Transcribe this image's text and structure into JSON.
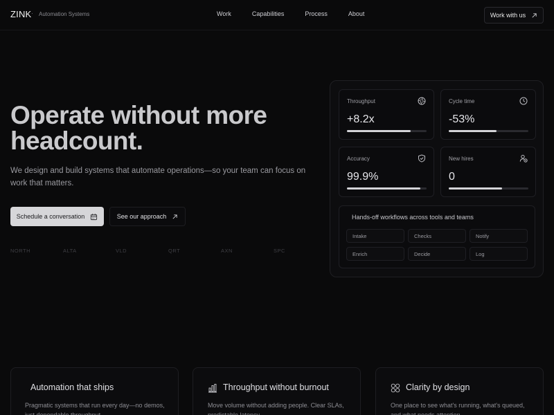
{
  "brand": {
    "name": "ZINK",
    "separator": "·",
    "tagline": "Automation Systems"
  },
  "nav": {
    "links": [
      "Work",
      "Capabilities",
      "Process",
      "About"
    ],
    "cta": "Work with us"
  },
  "hero": {
    "title": "Operate without more headcount.",
    "subtitle": "We design and build systems that automate operations—so your team can focus on work that matters.",
    "primary_cta": "Schedule a conversation",
    "secondary_cta": "See our approach",
    "logos": [
      "NORTH",
      "ALTA",
      "VLD",
      "QRT",
      "AXN",
      "SPC"
    ]
  },
  "dashboard": {
    "metrics": [
      {
        "label": "Throughput",
        "value": "+8.2x",
        "icon": "aperture-icon",
        "progress": 0.8
      },
      {
        "label": "Cycle time",
        "value": "-53%",
        "icon": "clock-icon",
        "progress": 0.6
      },
      {
        "label": "Accuracy",
        "value": "99.9%",
        "icon": "shield-check-icon",
        "progress": 0.92
      },
      {
        "label": "New hires",
        "value": "0",
        "icon": "user-minus-icon",
        "progress": 0.67
      }
    ],
    "workflows": {
      "title": "Hands-off workflows across tools and teams",
      "chips": [
        "Intake",
        "Checks",
        "Notify",
        "Enrich",
        "Decide",
        "Log"
      ]
    }
  },
  "features": [
    {
      "title": "Automation that ships",
      "body": "Pragmatic systems that run every day—no demos, just dependable throughput.",
      "icon": ""
    },
    {
      "title": "Throughput without burnout",
      "body": "Move volume without adding people. Clear SLAs, predictable latency.",
      "icon": "bar-chart-icon"
    },
    {
      "title": "Clarity by design",
      "body": "One place to see what's running, what's queued, and what needs attention.",
      "icon": "grid-icon"
    }
  ],
  "colors": {
    "background": "#0a0a0b",
    "primary_button": "#d6d6d9",
    "border": "#1f1f23",
    "progress": "#d4d4d8"
  }
}
